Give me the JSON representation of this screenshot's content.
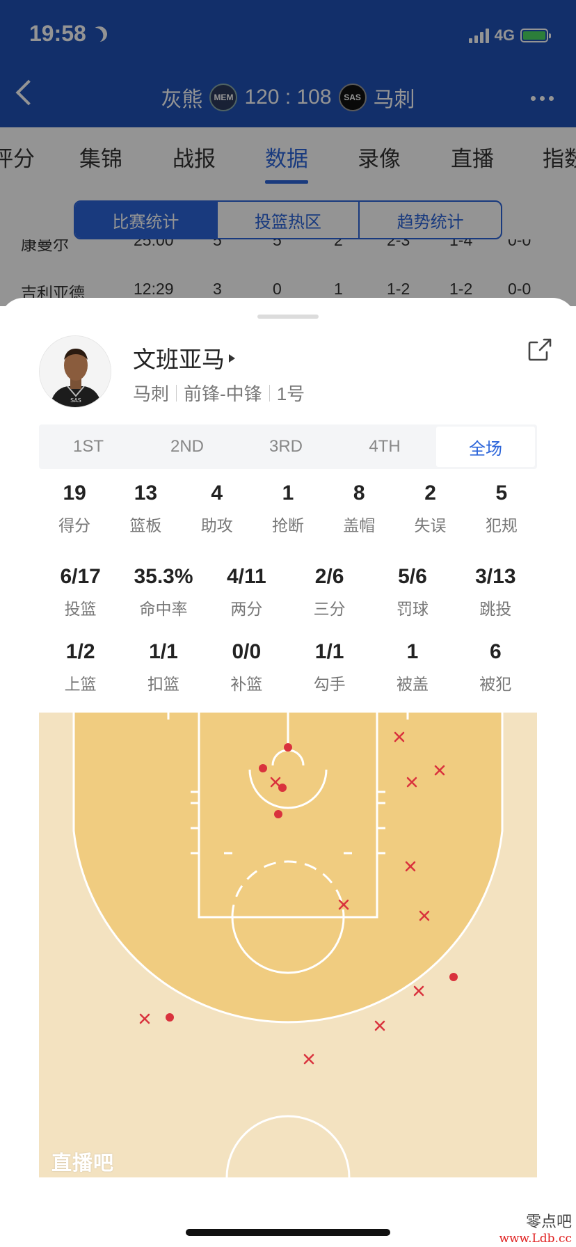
{
  "status_bar": {
    "time": "19:58",
    "network": "4G"
  },
  "game_header": {
    "home_team": "灰熊",
    "home_abbr": "MEM",
    "score": "120 : 108",
    "away_abbr": "SAS",
    "away_team": "马刺"
  },
  "tabs": [
    "评分",
    "集锦",
    "战报",
    "数据",
    "录像",
    "直播",
    "指数"
  ],
  "active_tab": "数据",
  "segments": [
    "比赛统计",
    "投篮热区",
    "趋势统计"
  ],
  "active_segment": "比赛统计",
  "background_rows": [
    [
      "康曼尔",
      "25:00",
      "5",
      "5",
      "2",
      "2-3",
      "1-4",
      "0-0"
    ],
    [
      "吉利亚德",
      "12:29",
      "3",
      "0",
      "1",
      "1-2",
      "1-2",
      "0-0"
    ]
  ],
  "player": {
    "name": "文班亚马",
    "team": "马刺",
    "position": "前锋-中锋",
    "number": "1号"
  },
  "periods": [
    "1ST",
    "2ND",
    "3RD",
    "4TH",
    "全场"
  ],
  "active_period": "全场",
  "stats_row1": [
    {
      "value": "19",
      "label": "得分"
    },
    {
      "value": "13",
      "label": "篮板"
    },
    {
      "value": "4",
      "label": "助攻"
    },
    {
      "value": "1",
      "label": "抢断"
    },
    {
      "value": "8",
      "label": "盖帽"
    },
    {
      "value": "2",
      "label": "失误"
    },
    {
      "value": "5",
      "label": "犯规"
    }
  ],
  "stats_row2": [
    {
      "value": "6/17",
      "label": "投篮"
    },
    {
      "value": "35.3%",
      "label": "命中率"
    },
    {
      "value": "4/11",
      "label": "两分"
    },
    {
      "value": "2/6",
      "label": "三分"
    },
    {
      "value": "5/6",
      "label": "罚球"
    },
    {
      "value": "3/13",
      "label": "跳投"
    }
  ],
  "stats_row3": [
    {
      "value": "1/2",
      "label": "上篮"
    },
    {
      "value": "1/1",
      "label": "扣篮"
    },
    {
      "value": "0/0",
      "label": "补篮"
    },
    {
      "value": "1/1",
      "label": "勾手"
    },
    {
      "value": "1",
      "label": "被盖"
    },
    {
      "value": "6",
      "label": "被犯"
    }
  ],
  "shot_chart": {
    "made_color": "#d9323d",
    "miss_color": "#d9323d",
    "court_color": "#f0cc80",
    "outer_color": "#f3e2c0"
  },
  "court_watermark": "直播吧",
  "corner_watermark": {
    "line1": "零点吧",
    "line2": "www.Ldb.cc"
  },
  "colors": {
    "header_blue": "#1f51b7",
    "accent": "#2b64d9"
  }
}
